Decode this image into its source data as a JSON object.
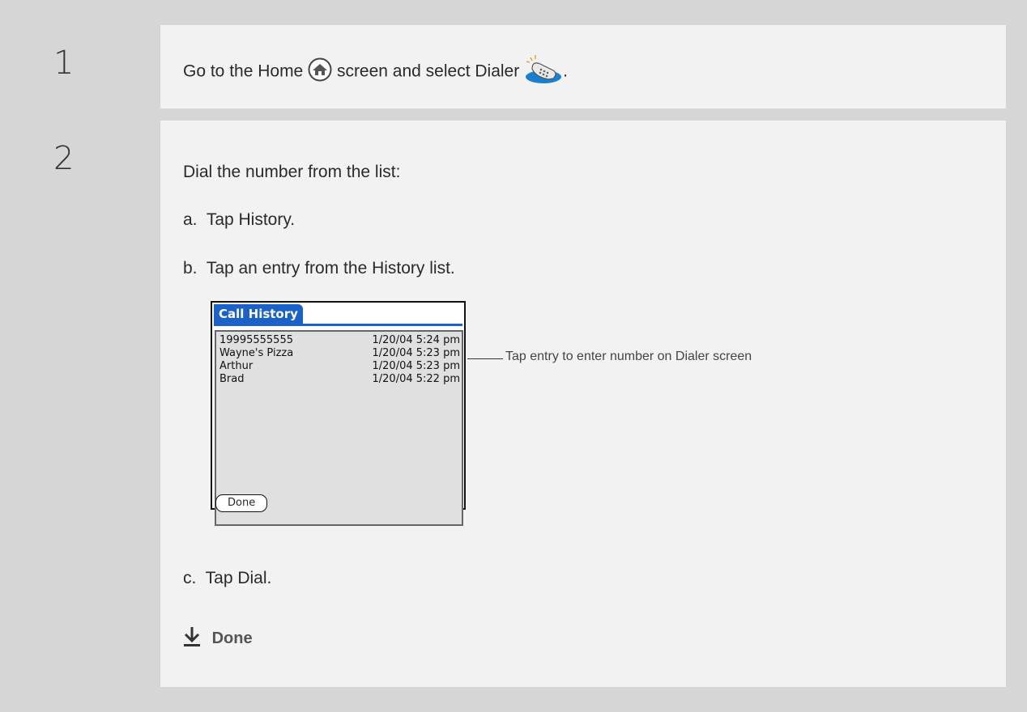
{
  "steps": [
    {
      "number": "1",
      "text_before_home": "Go to the Home",
      "text_after_home": "screen and select Dialer",
      "text_end": "."
    },
    {
      "number": "2",
      "intro": "Dial the number from the list:",
      "sub": [
        {
          "label": "a.",
          "text": "Tap History."
        },
        {
          "label": "b.",
          "text": "Tap an entry from the History list."
        },
        {
          "label": "c.",
          "text": "Tap Dial."
        }
      ]
    }
  ],
  "call_history": {
    "title": "Call History",
    "entries": [
      {
        "name": "19995555555",
        "when": "1/20/04 5:24 pm"
      },
      {
        "name": "Wayne's Pizza",
        "when": "1/20/04 5:23 pm"
      },
      {
        "name": "Arthur",
        "when": "1/20/04 5:23 pm"
      },
      {
        "name": "Brad",
        "when": "1/20/04 5:22 pm"
      }
    ],
    "done_button": "Done"
  },
  "callout": "Tap entry to enter number on Dialer screen",
  "done_label": "Done",
  "colors": {
    "accent": "#1b62c8",
    "panel": "#f2f2f2",
    "frame": "#d6d6d6"
  },
  "icons": [
    "home-icon",
    "dialer-icon",
    "done-arrow-icon"
  ]
}
